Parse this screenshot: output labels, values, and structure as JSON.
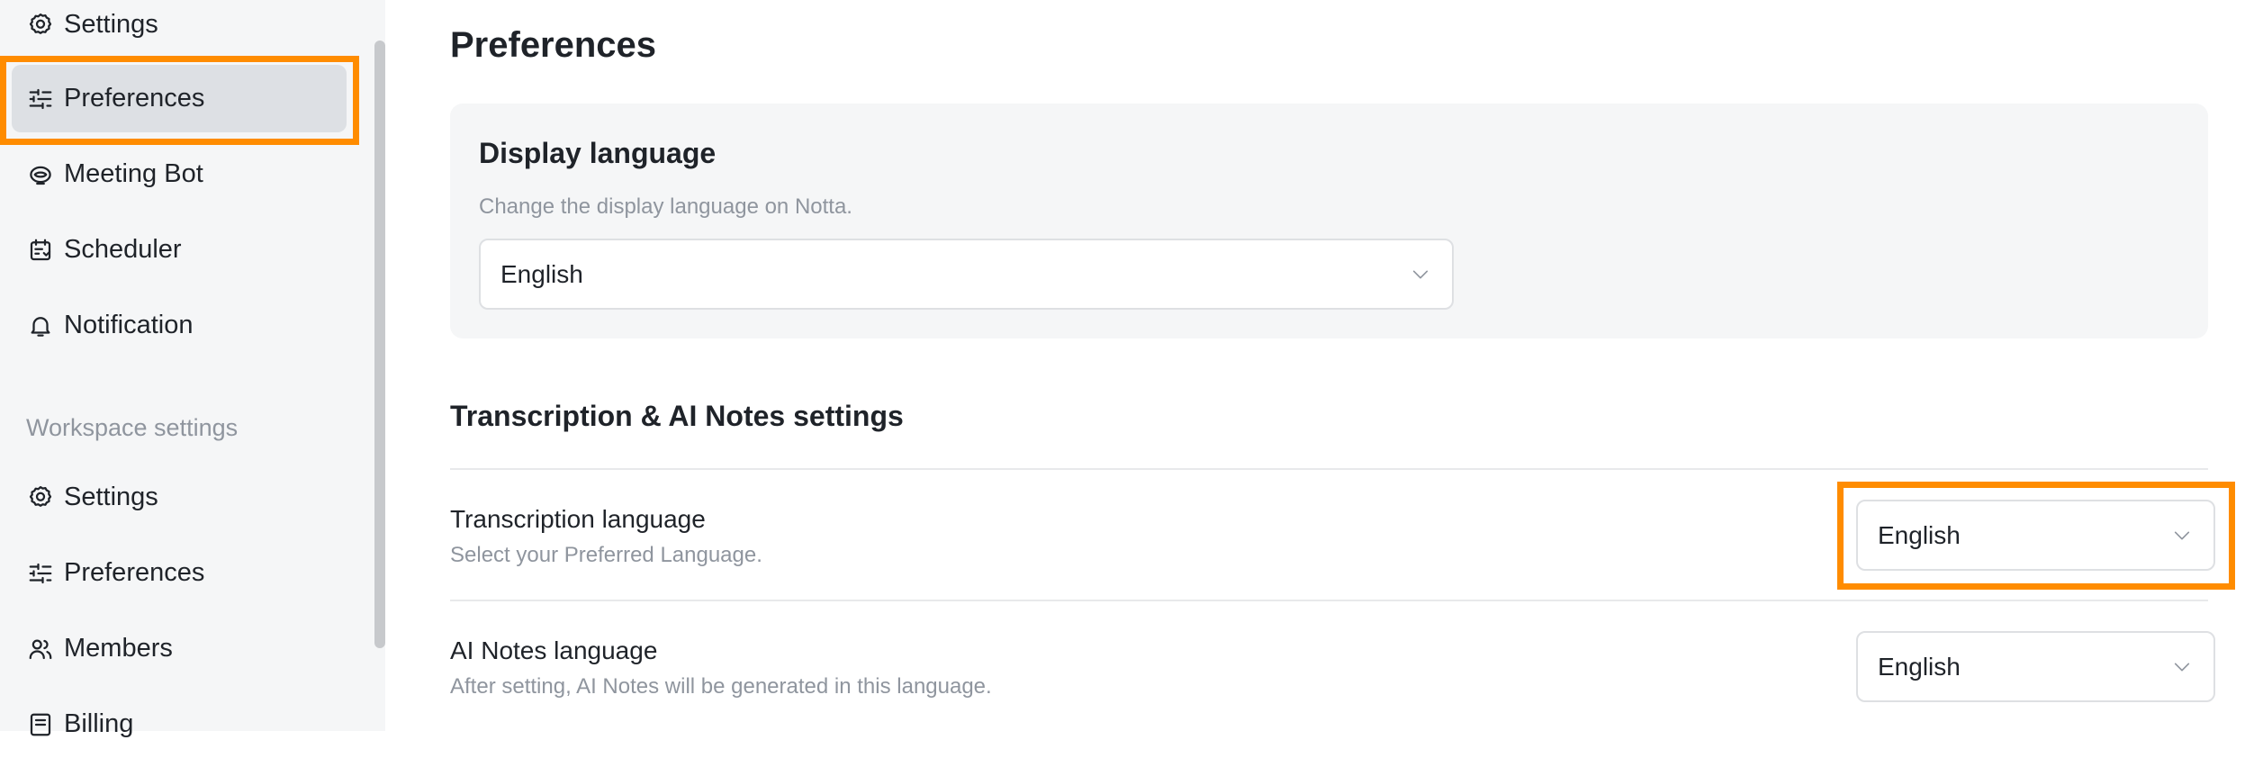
{
  "sidebar": {
    "personal_items": [
      {
        "label": "Settings",
        "icon": "gear-icon"
      },
      {
        "label": "Preferences",
        "icon": "sliders-icon",
        "active": true
      },
      {
        "label": "Meeting Bot",
        "icon": "bot-icon"
      },
      {
        "label": "Scheduler",
        "icon": "calendar-icon"
      },
      {
        "label": "Notification",
        "icon": "bell-icon"
      }
    ],
    "workspace_section_label": "Workspace settings",
    "workspace_items": [
      {
        "label": "Settings",
        "icon": "gear-icon"
      },
      {
        "label": "Preferences",
        "icon": "sliders-icon"
      },
      {
        "label": "Members",
        "icon": "members-icon"
      },
      {
        "label": "Billing",
        "icon": "billing-icon"
      }
    ]
  },
  "main": {
    "title": "Preferences",
    "display_language": {
      "title": "Display language",
      "description": "Change the display language on Notta.",
      "selected": "English"
    },
    "transcription_section": {
      "title": "Transcription & AI Notes settings",
      "transcription_language": {
        "label": "Transcription language",
        "description": "Select your Preferred Language.",
        "selected": "English"
      },
      "ai_notes_language": {
        "label": "AI Notes language",
        "description": "After setting, AI Notes will be generated in this language.",
        "selected": "English"
      }
    }
  },
  "colors": {
    "highlight": "#ff8c00",
    "sidebar_bg": "#f5f6f7",
    "active_item_bg": "#dde0e4",
    "muted_text": "#8f959e"
  }
}
